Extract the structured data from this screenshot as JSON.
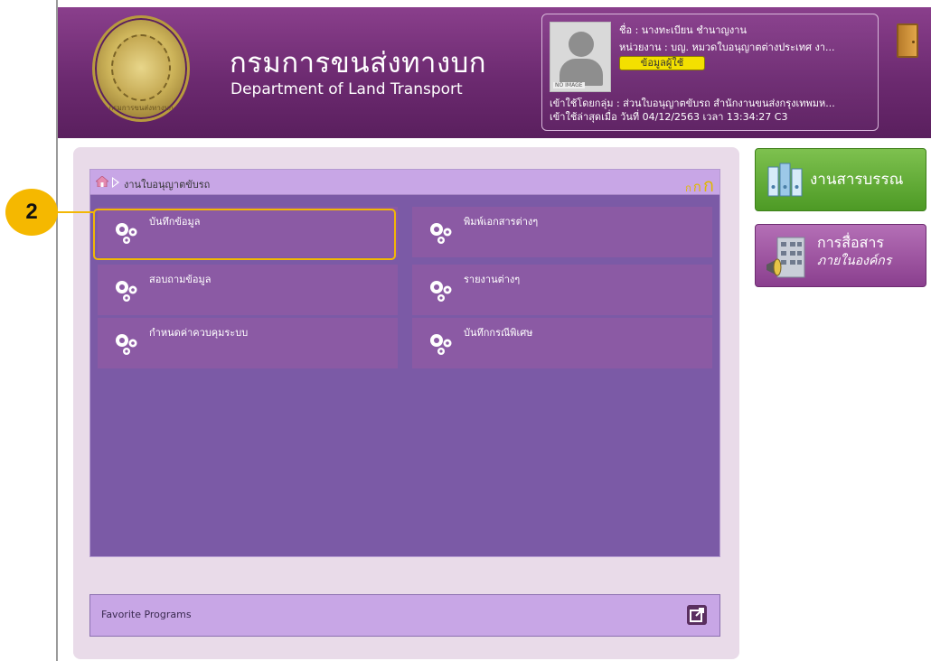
{
  "header": {
    "logo_th": "กรมการขนส่งทางบก",
    "logo_en": "Department of Land Transport",
    "seal_text": "กรมการขนส่งทางบก"
  },
  "user": {
    "name_line": "ชื่อ :  นางทะเบียน ชำนาญงาน",
    "unit_line": "หน่วยงาน : บญ. หมวดใบอนุญาตต่างประเทศ งา...",
    "info_button": "ข้อมูลผู้ใช้",
    "group_line": "เข้าใช้โดยกลุ่ม : ส่วนใบอนุญาตขับรถ สำนักงานขนส่งกรุงเทพมห...",
    "last_login_line": "เข้าใช้ล่าสุดเมื่อ วันที่ 04/12/2563 เวลา 13:34:27 C3",
    "avatar_tag": "NO IMAGE"
  },
  "breadcrumb": {
    "label": "งานใบอนุญาตขับรถ"
  },
  "font_sizes": [
    "ก",
    "ก",
    "ก"
  ],
  "menu": {
    "tiles": [
      {
        "label": "บันทึกข้อมูล"
      },
      {
        "label": "พิมพ์เอกสารต่างๆ"
      },
      {
        "label": "สอบถามข้อมูล"
      },
      {
        "label": "รายงานต่างๆ"
      },
      {
        "label": "กำหนดค่าควบคุมระบบ"
      },
      {
        "label": "บันทึกกรณีพิเศษ"
      }
    ]
  },
  "callout": {
    "number": "2",
    "color": "#f2b705"
  },
  "favorites": {
    "label": "Favorite Programs"
  },
  "side": {
    "green_label": "งานสารบรรณ",
    "purple_label_1": "การสื่อสาร",
    "purple_label_2": "ภายในองค์กร"
  },
  "icons": {
    "home": "home-icon",
    "arrow": "breadcrumb-arrow-icon",
    "gear": "gears-icon",
    "door": "logout-door-icon",
    "external": "open-external-icon"
  }
}
